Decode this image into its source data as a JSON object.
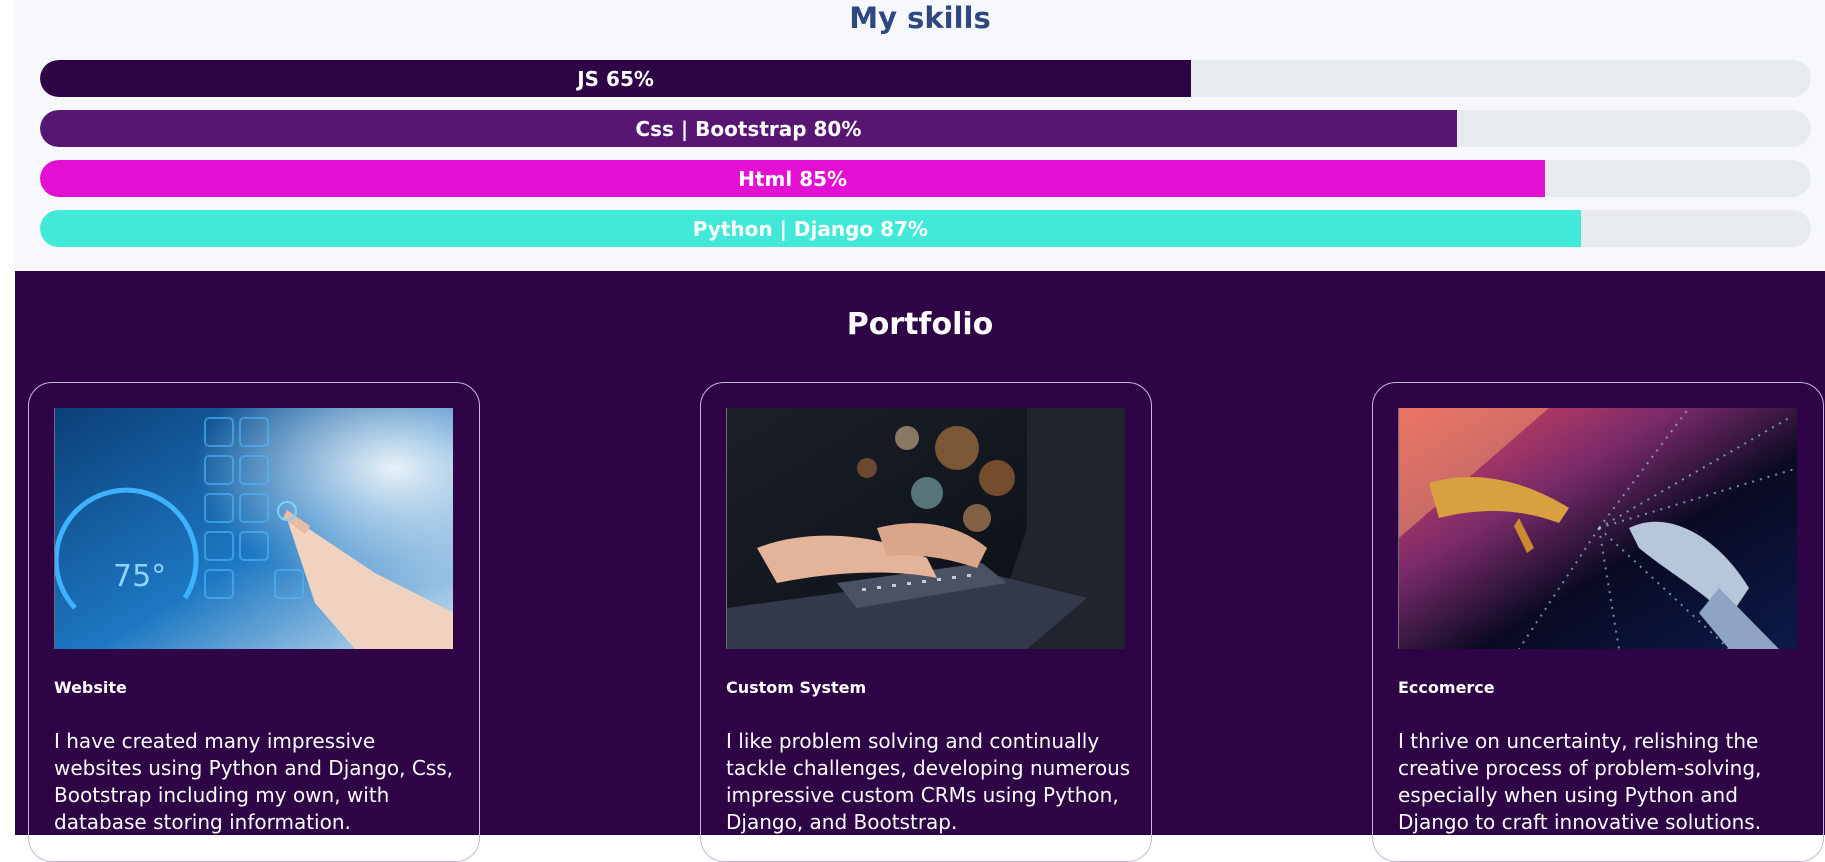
{
  "skills": {
    "title": "My skills",
    "bars": [
      {
        "label": "JS 65%",
        "percent": 65,
        "color": "#2f0447"
      },
      {
        "label": "Css | Bootstrap 80%",
        "percent": 80,
        "color": "#581673"
      },
      {
        "label": "Html 85%",
        "percent": 85,
        "color": "#e30fd2"
      },
      {
        "label": "Python | Django 87%",
        "percent": 87,
        "color": "#42e8d8"
      }
    ]
  },
  "portfolio": {
    "title": "Portfolio",
    "cards": [
      {
        "image_name": "touchscreen-dashboard-image",
        "title": "Website",
        "text": "I have created many impressive websites using Python and Django, Css, Bootstrap including my own, with database storing information."
      },
      {
        "image_name": "laptop-typing-image",
        "title": "Custom System",
        "text": "I like problem solving and continually tackle challenges, developing numerous impressive custom CRMs using Python, Django, and Bootstrap."
      },
      {
        "image_name": "human-robot-hands-image",
        "title": "Eccomerce",
        "text": "I thrive on uncertainty, relishing the creative process of problem-solving, especially when using Python and Django to craft innovative solutions."
      }
    ]
  },
  "colors": {
    "skills_background": "#f7f8fb",
    "skills_title": "#2e4780",
    "bar_track": "#e8ebee",
    "portfolio_background": "#2f0447"
  }
}
